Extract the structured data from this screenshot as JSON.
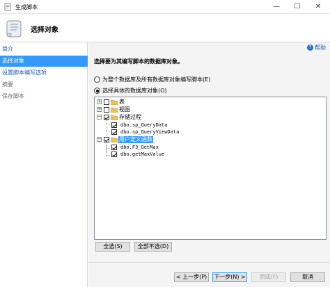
{
  "window": {
    "title": "生成脚本",
    "controls": {
      "minimize": "—",
      "maximize": "☐",
      "close": "✕"
    }
  },
  "header": {
    "title": "选择对象"
  },
  "nav": {
    "items": [
      {
        "label": "简介",
        "state": "normal"
      },
      {
        "label": "选择对象",
        "state": "selected"
      },
      {
        "label": "设置脚本编写选项",
        "state": "normal"
      },
      {
        "label": "摘要",
        "state": "disabled"
      },
      {
        "label": "保存脚本",
        "state": "disabled"
      }
    ]
  },
  "main": {
    "help_label": "帮助",
    "instruction": "选择要为其编写脚本的数据库对象。",
    "radio_all": "为整个数据库及所有数据库对象编写脚本(E)",
    "radio_specific": "选择具体的数据库对象(O)",
    "selected_radio": "specific",
    "tree": {
      "tables": "表",
      "views": "视图",
      "procedures": "存储过程",
      "procedure_items": [
        "dbo.sp_QueryData",
        "dbo.sp_QueryViewData"
      ],
      "functions": "用户定义函数",
      "function_items": [
        "dbo.F3_GetMax",
        "dbo.getMaxValue"
      ]
    },
    "select_all": "全选(S)",
    "deselect_all": "全部不选(D)"
  },
  "footer": {
    "previous": "< 上一步(P)",
    "next": "下一步(N) >",
    "finish": "完成(F)",
    "cancel": "取消"
  },
  "colors": {
    "selection": "#3399ff",
    "link": "#1a5fa8",
    "folder": "#e8c15a"
  }
}
